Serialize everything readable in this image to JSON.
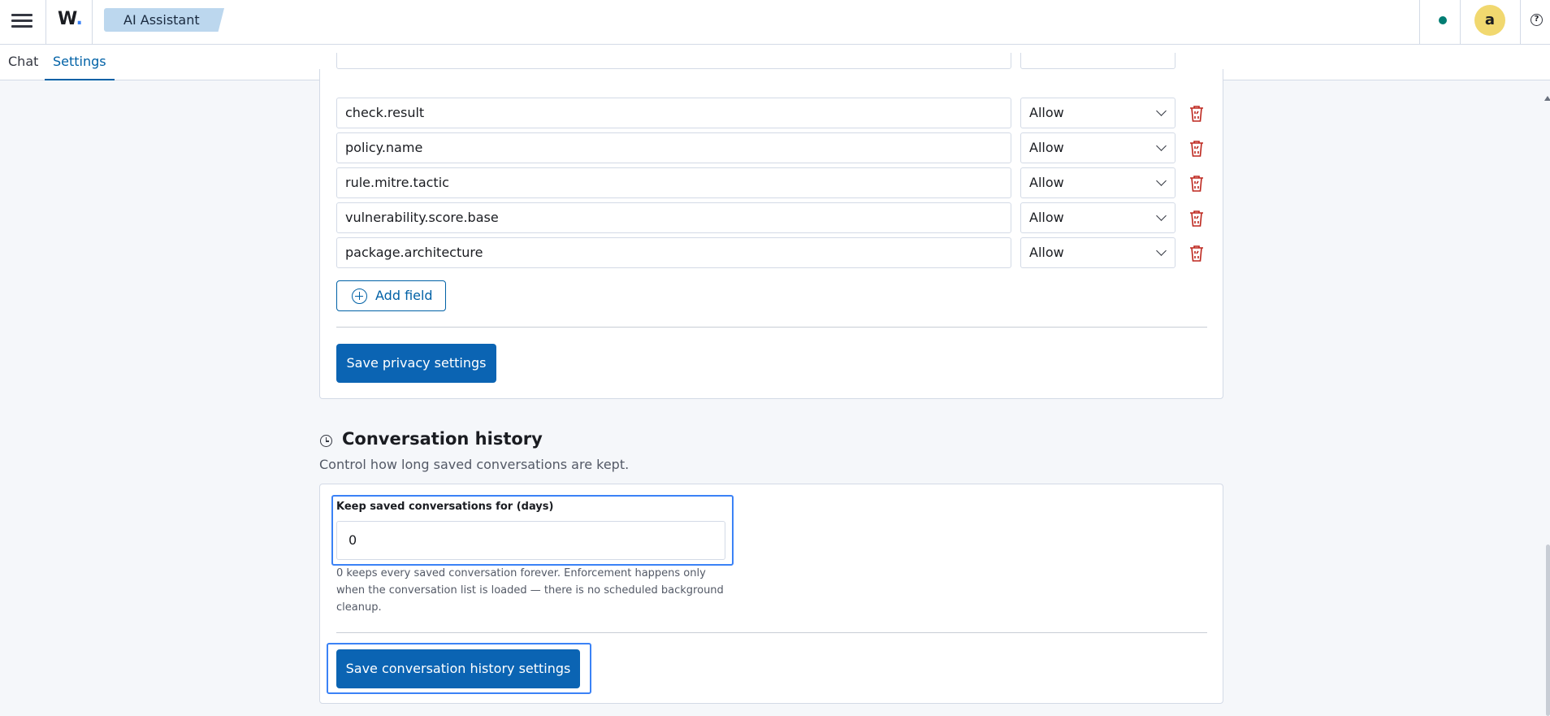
{
  "header": {
    "logo": "W",
    "logo_dot": ".",
    "app_name": "AI Assistant",
    "avatar_initial": "a",
    "help_glyph": "?",
    "status_color": "#017d73"
  },
  "tabs": [
    {
      "label": "Chat",
      "active": false
    },
    {
      "label": "Settings",
      "active": true
    }
  ],
  "privacy": {
    "fields": [
      {
        "name": "check.result",
        "mode": "Allow"
      },
      {
        "name": "policy.name",
        "mode": "Allow"
      },
      {
        "name": "rule.mitre.tactic",
        "mode": "Allow"
      },
      {
        "name": "vulnerability.score.base",
        "mode": "Allow"
      },
      {
        "name": "package.architecture",
        "mode": "Allow"
      }
    ],
    "add_field_label": "Add field",
    "save_label": "Save privacy settings"
  },
  "history": {
    "title": "Conversation history",
    "description": "Control how long saved conversations are kept.",
    "days_label": "Keep saved conversations for (days)",
    "days_value": "0",
    "help_text": "0 keeps every saved conversation forever. Enforcement happens only when the conversation list is loaded — there is no scheduled background cleanup.",
    "save_label": "Save conversation history settings"
  },
  "colors": {
    "primary": "#0b64b3",
    "danger": "#bd271e",
    "focus": "#3b82f6",
    "badge": "#bcd7ee"
  }
}
